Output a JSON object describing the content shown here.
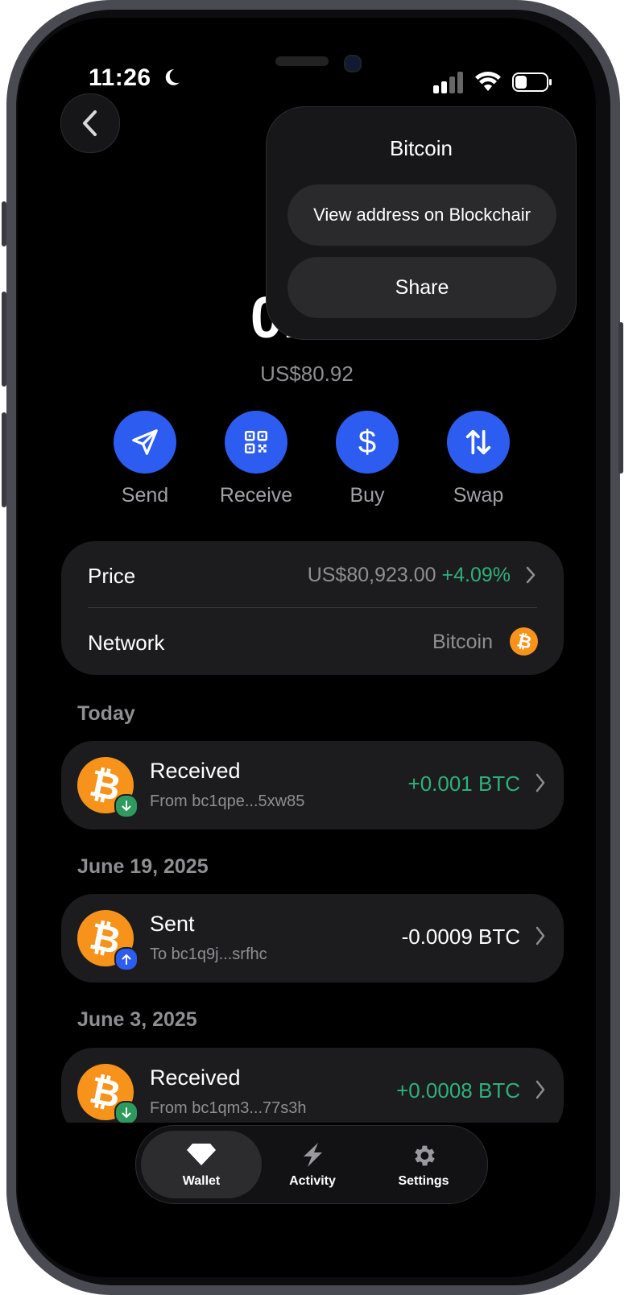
{
  "status": {
    "time": "11:26"
  },
  "wallet": {
    "balance": "0.00",
    "fiat": "US$80.92"
  },
  "actions": [
    {
      "label": "Send"
    },
    {
      "label": "Receive"
    },
    {
      "label": "Buy"
    },
    {
      "label": "Swap"
    }
  ],
  "info": {
    "price_label": "Price",
    "price_value": "US$80,923.00",
    "price_change": "+4.09%",
    "network_label": "Network",
    "network_value": "Bitcoin"
  },
  "transactions": [
    {
      "section": "Today",
      "title": "Received",
      "sub": "From bc1qpe...5xw85",
      "amount": "+0.001 BTC",
      "direction": "in"
    },
    {
      "section": "June 19, 2025",
      "title": "Sent",
      "sub": "To bc1q9j...srfhc",
      "amount": "-0.0009 BTC",
      "direction": "out"
    },
    {
      "section": "June 3, 2025",
      "title": "Received",
      "sub": "From bc1qm3...77s3h",
      "amount": "+0.0008 BTC",
      "direction": "in"
    }
  ],
  "tabs": [
    {
      "label": "Wallet",
      "active": true
    },
    {
      "label": "Activity",
      "active": false
    },
    {
      "label": "Settings",
      "active": false
    }
  ],
  "popover": {
    "title": "Bitcoin",
    "view_label": "View address on Blockchair",
    "share_label": "Share"
  },
  "colors": {
    "accent": "#2d5df0",
    "bitcoin": "#f7931a",
    "positive": "#30b07a",
    "background": "#000000",
    "card": "#1c1c1e"
  }
}
